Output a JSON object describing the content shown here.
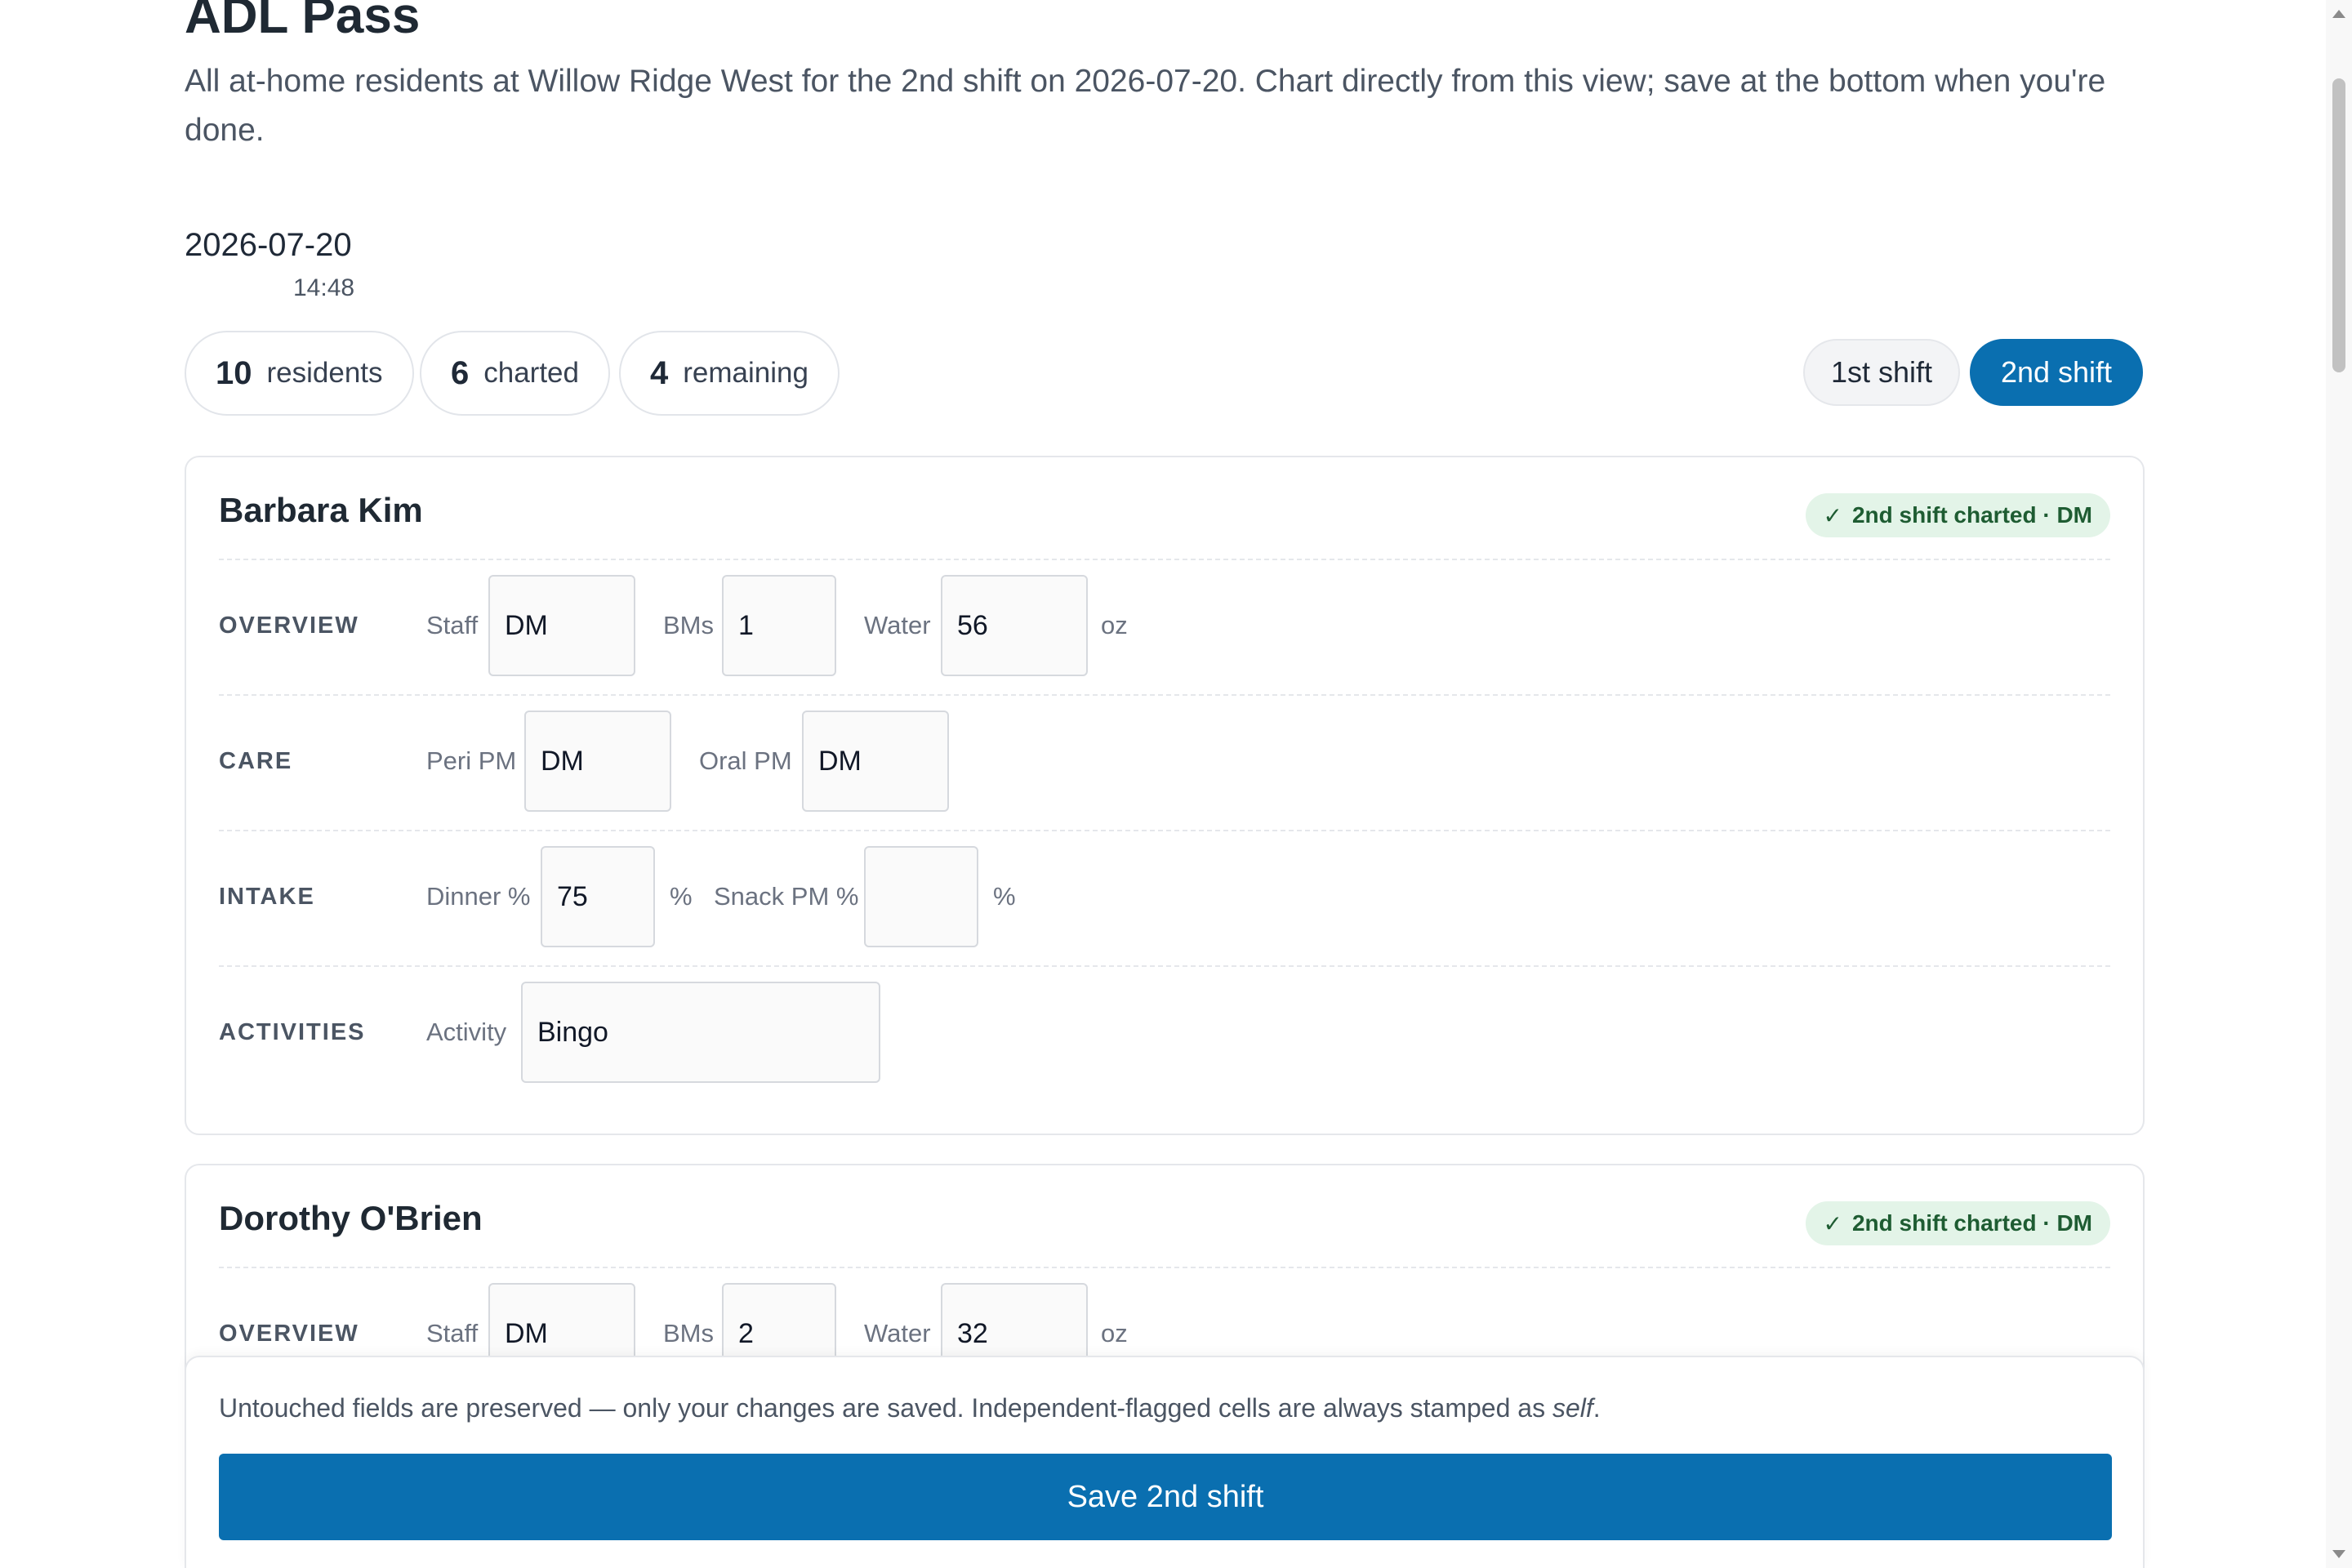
{
  "page": {
    "title": "ADL Pass",
    "subtitle": "All at-home residents at Willow Ridge West for the 2nd shift on 2026-07-20. Chart directly from this view; save at the bottom when you're done.",
    "date": "2026-07-20",
    "time": "14:48"
  },
  "stats": [
    {
      "num": "10",
      "label": "residents"
    },
    {
      "num": "6",
      "label": "charted"
    },
    {
      "num": "4",
      "label": "remaining"
    }
  ],
  "shifts": {
    "first": "1st shift",
    "second": "2nd shift",
    "active": "2nd shift"
  },
  "section_labels": {
    "overview": "OVERVIEW",
    "care": "CARE",
    "intake": "INTAKE",
    "activities": "ACTIVITIES"
  },
  "field_labels": {
    "staff": "Staff",
    "bms": "BMs",
    "water": "Water",
    "water_unit": "oz",
    "peri_pm": "Peri PM",
    "oral_pm": "Oral PM",
    "dinner": "Dinner %",
    "snack_pm": "Snack PM %",
    "percent": "%",
    "activity": "Activity"
  },
  "residents": [
    {
      "name": "Barbara Kim",
      "badge_check": "✓",
      "badge": "2nd shift charted · DM",
      "staff": "DM",
      "bms": "1",
      "water": "56",
      "peri_pm": "DM",
      "oral_pm": "DM",
      "dinner": "75",
      "snack_pm": "",
      "activity": "Bingo"
    },
    {
      "name": "Dorothy O'Brien",
      "badge_check": "✓",
      "badge": "2nd shift charted · DM",
      "staff": "DM",
      "bms": "2",
      "water": "32"
    }
  ],
  "footer": {
    "note_before": "Untouched fields are preserved — only your changes are saved. Independent-flagged cells are always stamped as ",
    "note_em": "self",
    "note_after": ".",
    "save_label": "Save 2nd shift"
  },
  "colors": {
    "accent": "#0a6fb0",
    "badge_bg": "#e3f4e8",
    "badge_text": "#1e5c32"
  }
}
